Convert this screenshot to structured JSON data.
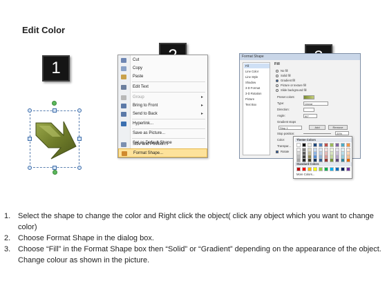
{
  "title": "Edit Color",
  "step_badges": [
    "1",
    "2",
    "3"
  ],
  "context_menu": {
    "items": [
      {
        "label": "Cut",
        "state": "normal",
        "icon": "scissors-icon",
        "icon_color": "#6e86b3"
      },
      {
        "label": "Copy",
        "state": "normal",
        "icon": "copy-icon",
        "icon_color": "#8aa2c8"
      },
      {
        "label": "Paste",
        "state": "normal",
        "icon": "paste-icon",
        "icon_color": "#c9a14b"
      },
      {
        "label": "Edit Text",
        "state": "normal",
        "icon": "edit-text-icon",
        "icon_color": "#6c7f9e"
      },
      {
        "label": "Group",
        "state": "disabled",
        "icon": "group-icon",
        "icon_color": "#b8b8b8",
        "submenu": true
      },
      {
        "label": "Bring to Front",
        "state": "normal",
        "icon": "bring-front-icon",
        "icon_color": "#5b79a8",
        "submenu": true
      },
      {
        "label": "Send to Back",
        "state": "normal",
        "icon": "send-back-icon",
        "icon_color": "#5b79a8",
        "submenu": true
      },
      {
        "label": "Hyperlink...",
        "state": "normal",
        "icon": "hyperlink-icon",
        "icon_color": "#3b6fb0"
      },
      {
        "label": "Save as Picture...",
        "state": "normal",
        "icon": "",
        "icon_color": ""
      },
      {
        "label": "Set as Default Shape",
        "state": "normal",
        "icon": "",
        "icon_color": ""
      },
      {
        "label": "Size and Position...",
        "state": "normal",
        "icon": "size-position-icon",
        "icon_color": "#7b8fb0"
      },
      {
        "label": "Format Shape...",
        "state": "highlighted",
        "icon": "format-shape-icon",
        "icon_color": "#d08a2e"
      }
    ]
  },
  "dialog": {
    "title": "Format Shape",
    "sidebar": [
      "Fill",
      "Line Color",
      "Line Style",
      "Shadow",
      "3-D Format",
      "3-D Rotation",
      "Picture",
      "Text Box"
    ],
    "selected_sidebar": "Fill",
    "section_title": "Fill",
    "fill_options": [
      {
        "label": "No fill",
        "selected": false
      },
      {
        "label": "Solid fill",
        "selected": false
      },
      {
        "label": "Gradient fill",
        "selected": true
      },
      {
        "label": "Picture or texture fill",
        "selected": false
      },
      {
        "label": "Slide background fill",
        "selected": false
      }
    ],
    "fields": {
      "preset_label": "Preset colors:",
      "type_label": "Type:",
      "type_value": "Linear",
      "direction_label": "Direction:",
      "angle_label": "Angle:",
      "angle_value": "90°",
      "gradient_stops_label": "Gradient stops",
      "stop_value": "Stop 1",
      "add_label": "Add",
      "remove_label": "Remove",
      "stop_position_label": "Stop position:",
      "stop_position_value": "20%",
      "color_label": "Color:",
      "transparency_label": "Transpar...",
      "rotate_label": "Rotate"
    }
  },
  "palette": {
    "theme_label": "Theme Colors",
    "standard_label": "Standard Colors",
    "more_label": "More Colors...",
    "theme_top_row": [
      "#ffffff",
      "#000000",
      "#eeece1",
      "#1f497d",
      "#4f81bd",
      "#c0504d",
      "#9bbb59",
      "#8064a2",
      "#4bacc6",
      "#f79646"
    ],
    "theme_shades": [
      [
        "#f2f2f2",
        "#7f7f7f",
        "#ddd9c3",
        "#c6d9f0",
        "#dbe5f1",
        "#f2dcdb",
        "#ebf1dd",
        "#e5e0ec",
        "#dbeef3",
        "#fdeada"
      ],
      [
        "#d8d8d8",
        "#595959",
        "#c4bd97",
        "#8db3e2",
        "#b8cce4",
        "#e5b9b7",
        "#d7e3bc",
        "#ccc1d9",
        "#b7dde8",
        "#fbd5b5"
      ],
      [
        "#bfbfbf",
        "#3f3f3f",
        "#938953",
        "#548dd4",
        "#95b3d7",
        "#d99694",
        "#c3d69b",
        "#b2a2c7",
        "#92cddc",
        "#fac08f"
      ],
      [
        "#a5a5a5",
        "#262626",
        "#494429",
        "#17365d",
        "#366092",
        "#953734",
        "#76923c",
        "#5f497a",
        "#31859b",
        "#e36c09"
      ]
    ],
    "standard_colors": [
      "#c00000",
      "#ff0000",
      "#ffc000",
      "#ffff00",
      "#92d050",
      "#00b050",
      "#00b0f0",
      "#0070c0",
      "#002060",
      "#7030a0"
    ]
  },
  "instructions": [
    {
      "number": "1.",
      "text": "Select the shape to change the color and Right click the object( click any object which you want to change color)"
    },
    {
      "number": "2.",
      "text": "Choose Format Shape in the dialog box."
    },
    {
      "number": "3.",
      "text": "Choose “Fill” in the Format Shape box then “Solid” or “Gradient” depending on the appearance of the object. Change colour as shown in the picture."
    }
  ]
}
